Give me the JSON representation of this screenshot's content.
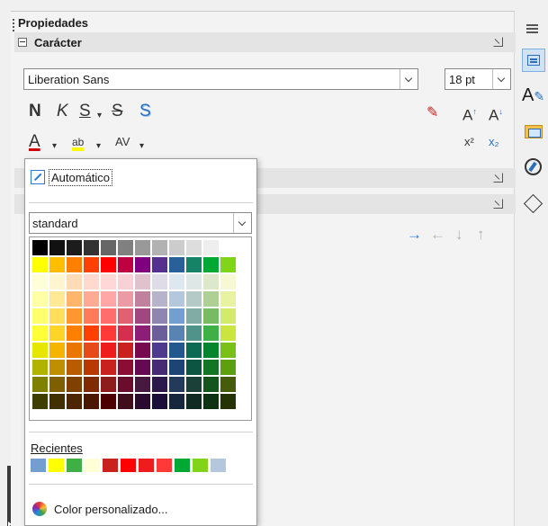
{
  "panel": {
    "title": "Propiedades",
    "section_title": "Carácter"
  },
  "font": {
    "name": "Liberation Sans",
    "size": "18 pt"
  },
  "format_buttons": {
    "bold": "N",
    "italic": "K",
    "underline": "S",
    "strikethrough": "S",
    "shadow": "S",
    "font_color": "A",
    "highlight": "ab",
    "spacing": "AV",
    "superscript": "x²",
    "subscript": "x₂"
  },
  "color_popup": {
    "automatic_label": "Automático",
    "palette": "standard",
    "recent_label": "Recientes",
    "custom_label": "Color personalizado...",
    "grid": [
      [
        "#000000",
        "#111111",
        "#1c1c1c",
        "#333333",
        "#666666",
        "#808080",
        "#999999",
        "#b2b2b2",
        "#cccccc",
        "#dddddd",
        "#eeeeee",
        "#ffffff"
      ],
      [
        "#ffff00",
        "#ffbf00",
        "#ff8000",
        "#ff4000",
        "#ff0000",
        "#bf0041",
        "#800080",
        "#55308d",
        "#2a6099",
        "#158466",
        "#00a933",
        "#81d41a"
      ],
      [
        "#ffffd7",
        "#fff5ce",
        "#ffdbb6",
        "#ffd8ce",
        "#ffd7d7",
        "#f7d1d5",
        "#e0c2cd",
        "#dedce6",
        "#dee6ef",
        "#dee7e5",
        "#dde8cb",
        "#f6f9d4"
      ],
      [
        "#ffffa6",
        "#ffe994",
        "#ffb66c",
        "#ffaa95",
        "#ffa6a6",
        "#ec9ba4",
        "#bf819e",
        "#b7b3ca",
        "#b4c7dc",
        "#b3cac7",
        "#afd095",
        "#e8f2a1"
      ],
      [
        "#ffff6d",
        "#ffde59",
        "#ff972f",
        "#ff7b59",
        "#ff6d6d",
        "#e16173",
        "#a1467e",
        "#8e86ae",
        "#729fcf",
        "#81aca6",
        "#77bc65",
        "#d4ea6b"
      ],
      [
        "#ffff38",
        "#ffd428",
        "#ff8000",
        "#ff4000",
        "#ff3838",
        "#d62e4e",
        "#8d1d75",
        "#6b5e9b",
        "#5983b0",
        "#50938a",
        "#3faf46",
        "#c9e53e"
      ],
      [
        "#e6e600",
        "#f4b400",
        "#ea7500",
        "#e64a19",
        "#ee1c1c",
        "#c9211e",
        "#78094e",
        "#4f3b8e",
        "#23578d",
        "#0c6b52",
        "#06852d",
        "#7bc019"
      ],
      [
        "#b2b200",
        "#bf8f00",
        "#b85c00",
        "#b83a00",
        "#c9211e",
        "#8d0c36",
        "#650953",
        "#462b73",
        "#1e4473",
        "#0d5543",
        "#127622",
        "#5e9f0f"
      ],
      [
        "#7f7f00",
        "#7f6000",
        "#7f4000",
        "#7f2a00",
        "#8d1d1d",
        "#6a0c2b",
        "#481940",
        "#2d1a4d",
        "#233a5a",
        "#1b4038",
        "#14551e",
        "#455d0b"
      ],
      [
        "#3e3e00",
        "#423100",
        "#4d2600",
        "#4a1700",
        "#4d0000",
        "#3f0d1b",
        "#2a0a2e",
        "#1b0f3a",
        "#16263d",
        "#0f2a23",
        "#0c3213",
        "#263405"
      ]
    ],
    "recent": [
      "#729fcf",
      "#ffff00",
      "#3faf46",
      "#ffffd7",
      "#c9211e",
      "#ff0000",
      "#ee1c1c",
      "#ff3838",
      "#00a933",
      "#81d41a",
      "#b4c7dc"
    ]
  }
}
